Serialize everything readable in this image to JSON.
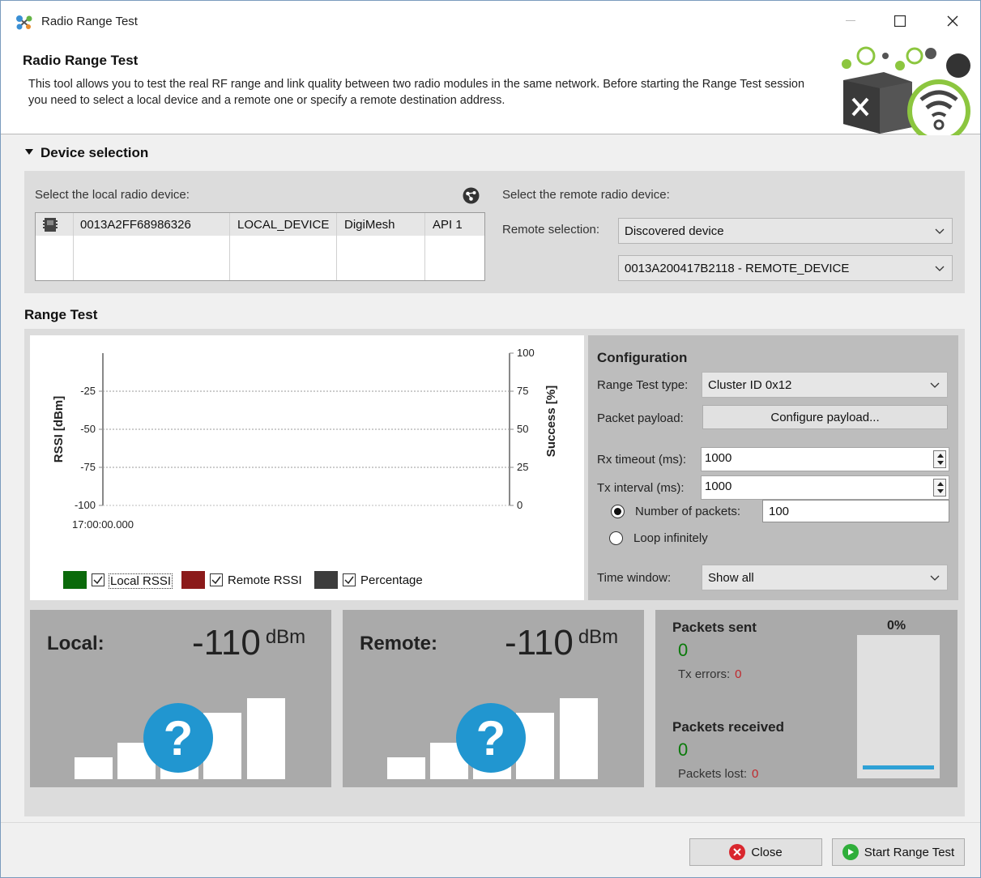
{
  "window": {
    "title": "Radio Range Test",
    "icons": {
      "app": "network-nodes-icon",
      "minimize": "minimize-icon",
      "maximize": "maximize-icon",
      "close": "close-icon"
    }
  },
  "header": {
    "title": "Radio Range Test",
    "description": "This tool allows you to test the real RF range and link quality between two radio modules in the same network. Before starting the Range Test session you need to select a local device and a remote one or specify a remote destination address."
  },
  "device_selection": {
    "section_title": "Device selection",
    "local_label": "Select the local radio device:",
    "remote_label": "Select the remote radio device:",
    "local_device": {
      "address": "0013A2FF68986326",
      "node_id": "LOCAL_DEVICE",
      "protocol": "DigiMesh",
      "mode": "API 1"
    },
    "remote_selection_label": "Remote selection:",
    "remote_selection_value": "Discovered device",
    "remote_device_value": "0013A200417B2118 - REMOTE_DEVICE"
  },
  "range_test": {
    "section_title": "Range Test",
    "legend": {
      "local": "Local RSSI",
      "remote": "Remote RSSI",
      "percentage": "Percentage"
    },
    "colors": {
      "local": "#0b6a0b",
      "remote": "#8b1a1a",
      "percentage": "#3c3c3c",
      "accent": "#2196d0"
    },
    "configuration": {
      "title": "Configuration",
      "type_label": "Range Test type:",
      "type_value": "Cluster ID 0x12",
      "payload_label": "Packet payload:",
      "payload_button": "Configure payload...",
      "rx_timeout_label": "Rx timeout (ms):",
      "rx_timeout_value": "1000",
      "tx_interval_label": "Tx interval (ms):",
      "tx_interval_value": "1000",
      "num_packets_label": "Number of packets:",
      "num_packets_value": "100",
      "loop_label": "Loop infinitely",
      "time_window_label": "Time window:",
      "time_window_value": "Show all"
    },
    "local": {
      "label": "Local:",
      "value": "-110",
      "unit": "dBm"
    },
    "remote": {
      "label": "Remote:",
      "value": "-110",
      "unit": "dBm"
    },
    "stats": {
      "packets_sent_label": "Packets sent",
      "packets_sent": "0",
      "tx_errors_label": "Tx errors:",
      "tx_errors": "0",
      "packets_received_label": "Packets received",
      "packets_received": "0",
      "packets_lost_label": "Packets lost:",
      "packets_lost": "0",
      "percent_label": "0%"
    }
  },
  "chart_data": {
    "type": "line",
    "ylabel": "RSSI [dBm]",
    "y2label": "Success [%]",
    "ylim": [
      -100,
      0
    ],
    "y2lim": [
      0,
      100
    ],
    "yticks": [
      "-25",
      "-50",
      "-75",
      "-100"
    ],
    "y2ticks": [
      "100",
      "75",
      "50",
      "25",
      "0"
    ],
    "xticks": [
      "17:00:00.000"
    ],
    "series": [],
    "grid": true
  },
  "footer": {
    "close_label": "Close",
    "start_label": "Start Range Test"
  }
}
